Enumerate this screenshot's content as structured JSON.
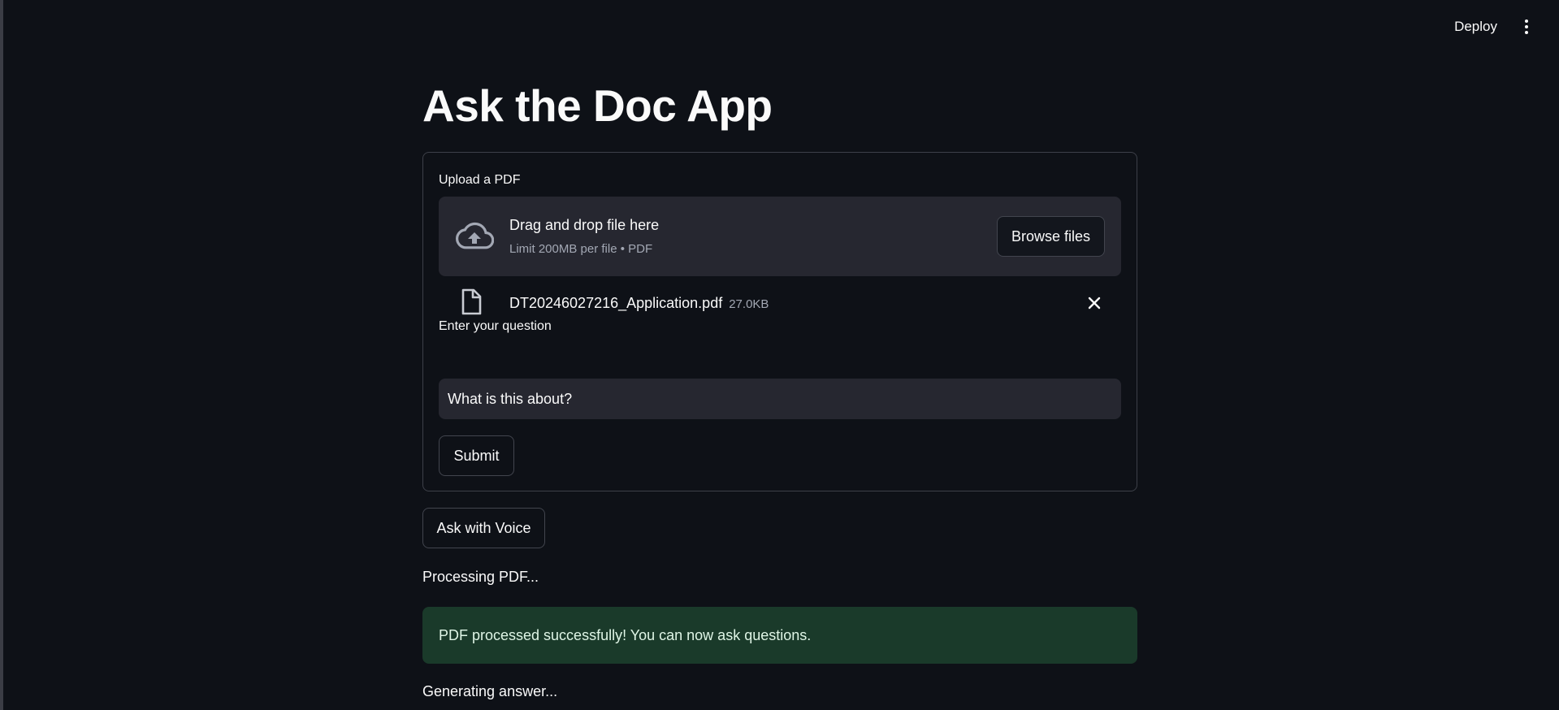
{
  "header": {
    "deploy_label": "Deploy",
    "menu_icon": "vertical-dots-icon"
  },
  "page": {
    "title": "Ask the Doc App"
  },
  "form": {
    "upload_label": "Upload a PDF",
    "dropzone": {
      "icon": "cloud-upload-icon",
      "title": "Drag and drop file here",
      "subtitle": "Limit 200MB per file • PDF",
      "browse_label": "Browse files"
    },
    "uploaded_file": {
      "icon": "file-icon",
      "name": "DT20246027216_Application.pdf",
      "size": "27.0KB",
      "remove_icon": "close-icon"
    },
    "question_label": "Enter your question",
    "question_value": "What is this about?",
    "submit_label": "Submit"
  },
  "voice_button_label": "Ask with Voice",
  "status": {
    "processing": "Processing PDF...",
    "success": "PDF processed successfully! You can now ask questions.",
    "generating": "Generating answer..."
  },
  "colors": {
    "background": "#0e1117",
    "surface": "#262730",
    "success_bg": "#1a3a2a",
    "border": "#3d4049"
  }
}
